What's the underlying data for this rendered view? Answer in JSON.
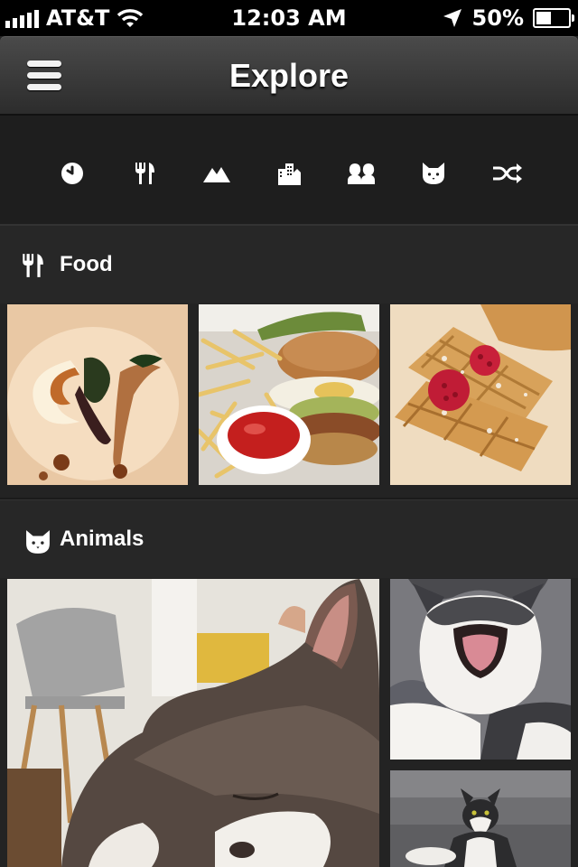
{
  "status_bar": {
    "carrier": "AT&T",
    "time": "12:03 AM",
    "battery_percent_label": "50%",
    "battery_level": 0.5,
    "icons": [
      "signal-icon",
      "wifi-icon",
      "location-arrow-icon",
      "battery-icon"
    ]
  },
  "nav": {
    "title": "Explore",
    "menu_icon": "hamburger-menu-icon"
  },
  "category_bar": {
    "items": [
      {
        "icon": "clock-icon"
      },
      {
        "icon": "fork-knife-icon"
      },
      {
        "icon": "mountains-icon"
      },
      {
        "icon": "buildings-icon"
      },
      {
        "icon": "people-icon"
      },
      {
        "icon": "cat-icon"
      },
      {
        "icon": "shuffle-icon"
      }
    ]
  },
  "sections": [
    {
      "title": "Food",
      "icon": "fork-knife-icon",
      "photos": [
        "fish-dish-photo",
        "burger-fries-photo",
        "waffles-raspberry-photo"
      ]
    },
    {
      "title": "Animals",
      "icon": "cat-icon",
      "photos": [
        "sleeping-cat-photo",
        "yawning-cat-photo",
        "cat-on-couch-photo"
      ]
    }
  ],
  "colors": {
    "background": "#232323",
    "navbar": "#3a3a3a",
    "text": "#ffffff"
  }
}
